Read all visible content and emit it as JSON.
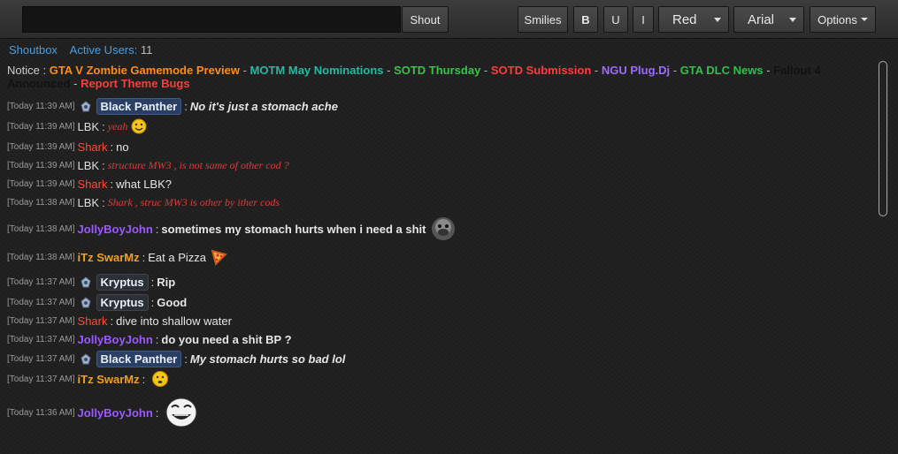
{
  "toolbar": {
    "shout_label": "Shout",
    "smilies_label": "Smilies",
    "bold_label": "B",
    "underline_label": "U",
    "italic_label": "I",
    "color_value": "Red",
    "font_value": "Arial",
    "options_label": "Options"
  },
  "subbar": {
    "tab_label": "Shoutbox",
    "active_users_label": "Active Users:",
    "active_users_count": "11"
  },
  "notice": {
    "label": "Notice :",
    "links": [
      {
        "text": "GTA V Zombie Gamemode Preview",
        "color": "#ff8c1a"
      },
      {
        "text": "MOTM May Nominations",
        "color": "#27b8a0"
      },
      {
        "text": "SOTD Thursday",
        "color": "#3cc04a"
      },
      {
        "text": "SOTD Submission",
        "color": "#ff3b3b"
      },
      {
        "text": "NGU Plug.Dj",
        "color": "#9a6cff"
      },
      {
        "text": "GTA DLC News",
        "color": "#2fbf4c"
      },
      {
        "text": "Fallout 4 Announced",
        "color": "#111111"
      },
      {
        "text": "Report Theme Bugs",
        "color": "#ff3b3b"
      }
    ]
  },
  "messages": [
    {
      "time": "[Today 11:39 AM]",
      "user": "Black Panther",
      "text": "No it's just a stomach ache"
    },
    {
      "time": "[Today 11:39 AM]",
      "user": "LBK",
      "text": "yeah"
    },
    {
      "time": "[Today 11:39 AM]",
      "user": "Shark",
      "text": "no"
    },
    {
      "time": "[Today 11:39 AM]",
      "user": "LBK",
      "text": "structure MW3 , is not same of other cod ?"
    },
    {
      "time": "[Today 11:39 AM]",
      "user": "Shark",
      "text": "what LBK?"
    },
    {
      "time": "[Today 11:38 AM]",
      "user": "LBK",
      "text": "Shark , struc MW3 is other by ither cods"
    },
    {
      "time": "[Today 11:38 AM]",
      "user": "JollyBoyJohn",
      "text": "sometimes my stomach hurts when i need a shit"
    },
    {
      "time": "[Today 11:38 AM]",
      "user": "iTz SwarMz",
      "text": "Eat a Pizza"
    },
    {
      "time": "[Today 11:37 AM]",
      "user": "Kryptus",
      "text": "Rip"
    },
    {
      "time": "[Today 11:37 AM]",
      "user": "Kryptus",
      "text": "Good"
    },
    {
      "time": "[Today 11:37 AM]",
      "user": "Shark",
      "text": "dive into shallow water"
    },
    {
      "time": "[Today 11:37 AM]",
      "user": "JollyBoyJohn",
      "text": "do you need a shit BP ?"
    },
    {
      "time": "[Today 11:37 AM]",
      "user": "Black Panther",
      "text": "My stomach hurts so bad lol"
    },
    {
      "time": "[Today 11:37 AM]",
      "user": "iTz SwarMz",
      "text": ""
    },
    {
      "time": "[Today 11:36 AM]",
      "user": "JollyBoyJohn",
      "text": ""
    }
  ],
  "colors": {
    "staff_badge_bg": "#2a3f63",
    "shark": "#ff4a3a",
    "jolly": "#9b59ff",
    "swarmz": "#f0a020",
    "link_blue": "#4a9ee0"
  }
}
